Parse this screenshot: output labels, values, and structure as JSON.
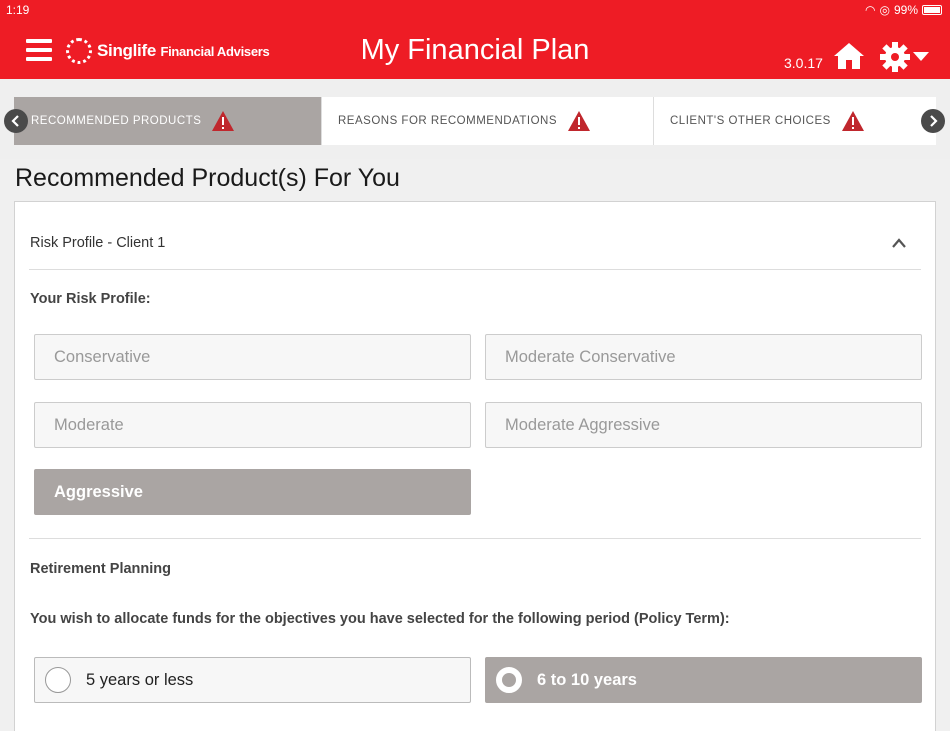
{
  "status": {
    "time": "1:19",
    "battery": "99%"
  },
  "header": {
    "brand": "Singlife",
    "brand_sub": "Financial Advisers",
    "title": "My Financial Plan",
    "version": "3.0.17"
  },
  "tabs": [
    {
      "label": "RECOMMENDED PRODUCTS",
      "active": true,
      "warning": true
    },
    {
      "label": "REASONS FOR RECOMMENDATIONS",
      "active": false,
      "warning": true
    },
    {
      "label": "CLIENT'S OTHER CHOICES",
      "active": false,
      "warning": true
    }
  ],
  "page": {
    "title": "Recommended Product(s) For You"
  },
  "risk_section": {
    "header": "Risk Profile - Client 1",
    "label": "Your Risk Profile:",
    "options": [
      {
        "label": "Conservative",
        "selected": false
      },
      {
        "label": "Moderate Conservative",
        "selected": false
      },
      {
        "label": "Moderate",
        "selected": false
      },
      {
        "label": "Moderate Aggressive",
        "selected": false
      },
      {
        "label": "Aggressive",
        "selected": true
      }
    ]
  },
  "retirement": {
    "title": "Retirement Planning",
    "question": "You wish to allocate funds for the objectives you have selected for the following period (Policy Term):",
    "options": [
      {
        "label": "5 years or less",
        "selected": false
      },
      {
        "label": "6 to 10 years",
        "selected": true
      }
    ]
  },
  "colors": {
    "brand_red": "#ee1c25",
    "selected_gray": "#aaa5a3",
    "warning_red": "#c0272d"
  }
}
